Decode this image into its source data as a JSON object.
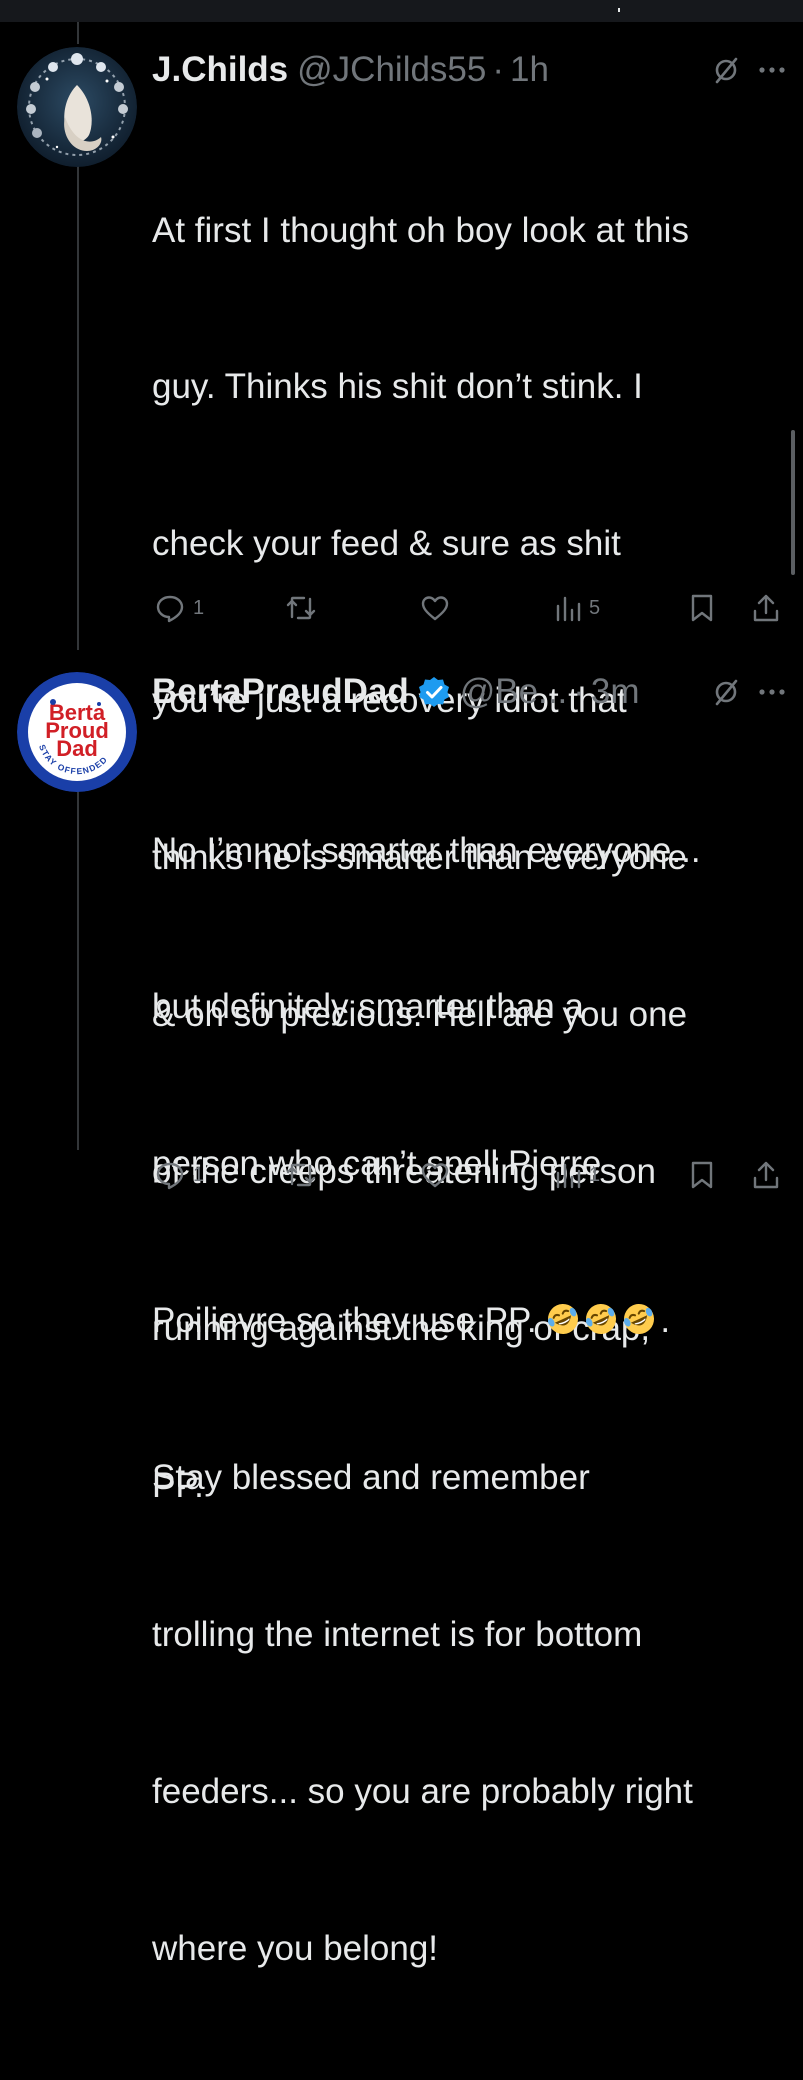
{
  "colors": {
    "background": "#000000",
    "text_primary": "#e7e9ea",
    "text_secondary": "#71767b",
    "verified_blue": "#1d9bf0"
  },
  "tweets": [
    {
      "display_name": "J.Childs",
      "handle": "@JChilds55",
      "separator": "·",
      "time": "1h",
      "verified": false,
      "avatar_icon": "moon-phases-avatar",
      "text": "At first I thought oh boy look at this guy. Thinks his shit don’t stink. I check your feed & sure as shit you’re just a recovery idiot that thinks he is smarter than everyone & oh so precious. Hell are you one of the creeps threatening person running against the king of crap, PP.",
      "lines": [
        "At first I thought oh boy look at this",
        "guy. Thinks his shit don’t stink. I",
        "check your feed & sure as shit",
        "you’re just a recovery idiot that",
        "thinks he is smarter than everyone",
        "& oh so precious. Hell are you one",
        "of the creeps threatening person",
        "running against the king of crap,",
        "PP."
      ],
      "stats": {
        "replies": "1",
        "retweets": "",
        "likes": "",
        "views": "5"
      }
    },
    {
      "display_name": "BertaProudDad",
      "handle": "@Be...",
      "separator": "·",
      "time": "3m",
      "verified": true,
      "avatar_icon": "berta-proud-dad-logo",
      "avatar_text": [
        "Berta",
        "Proud",
        "Dad"
      ],
      "avatar_ring_text": "STAY OFFENDED",
      "text": "No I’m not smarter than everyone... but definitely smarter than a person who can’t spell Pierre Poilievre so they use PP. 🤣🤣🤣. Stay blessed and remember trolling the internet is for bottom feeders... so you are probably right where you belong!",
      "lines": [
        "No I’m not smarter than everyone...",
        "but definitely smarter than a",
        "person who can’t spell Pierre",
        "Poilievre so they use PP.",
        "Stay blessed and remember",
        "trolling the internet is for bottom",
        "feeders... so you are probably right",
        "where you belong!"
      ],
      "emoji_suffix": ".",
      "emoji_name": "rolling-on-floor-laughing-emoji",
      "stats": {
        "replies": "1",
        "retweets": "",
        "likes": "",
        "views": "1"
      }
    }
  ]
}
